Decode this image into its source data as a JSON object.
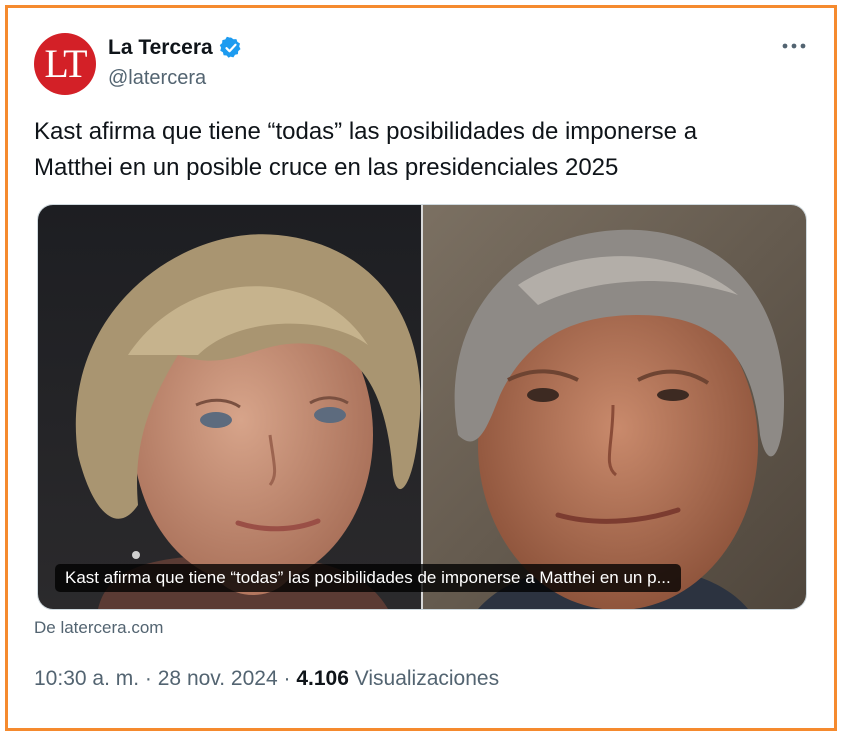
{
  "account": {
    "avatar_text": "LT",
    "name": "La Tercera",
    "handle": "@latercera"
  },
  "tweet": {
    "text_line1": "Kast afirma que tiene “todas” las posibilidades de imponerse a",
    "text_line2": "Matthei en un posible cruce en las presidenciales 2025"
  },
  "card": {
    "caption": "Kast afirma que tiene “todas” las posibilidades de imponerse a Matthei en un p...",
    "source": "De latercera.com"
  },
  "meta": {
    "time": "10:30 a. m.",
    "sep1": "·",
    "date": "28 nov. 2024",
    "sep2": "·",
    "views_count": "4.106",
    "views_label": "Visualizaciones"
  },
  "colors": {
    "frame": "#f58a2e",
    "avatar_bg": "#d32027",
    "verified": "#1d9bf0",
    "secondary_text": "#536471"
  }
}
